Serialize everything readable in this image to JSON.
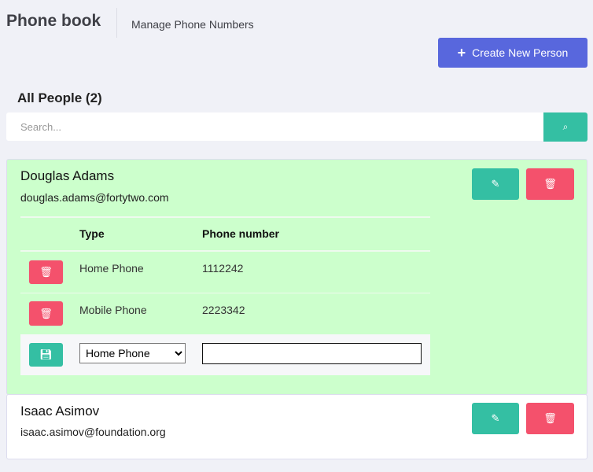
{
  "header": {
    "title": "Phone book",
    "subtitle": "Manage Phone Numbers",
    "create_label": "Create New Person"
  },
  "list": {
    "heading": "All People (2)",
    "search_placeholder": "Search...",
    "search_value": ""
  },
  "table": {
    "col_type": "Type",
    "col_number": "Phone number"
  },
  "people": [
    {
      "name": "Douglas Adams",
      "email": "douglas.adams@fortytwo.com",
      "highlighted": true,
      "phones": [
        {
          "type": "Home Phone",
          "number": "1112242"
        },
        {
          "type": "Mobile Phone",
          "number": "2223342"
        }
      ],
      "new_phone": {
        "type": "Home Phone",
        "number": ""
      }
    },
    {
      "name": "Isaac Asimov",
      "email": "isaac.asimov@foundation.org",
      "highlighted": false
    }
  ],
  "colors": {
    "accent": "#5867dd",
    "success": "#34bfa3",
    "danger": "#f4516c",
    "highlight": "#ccffcc"
  }
}
